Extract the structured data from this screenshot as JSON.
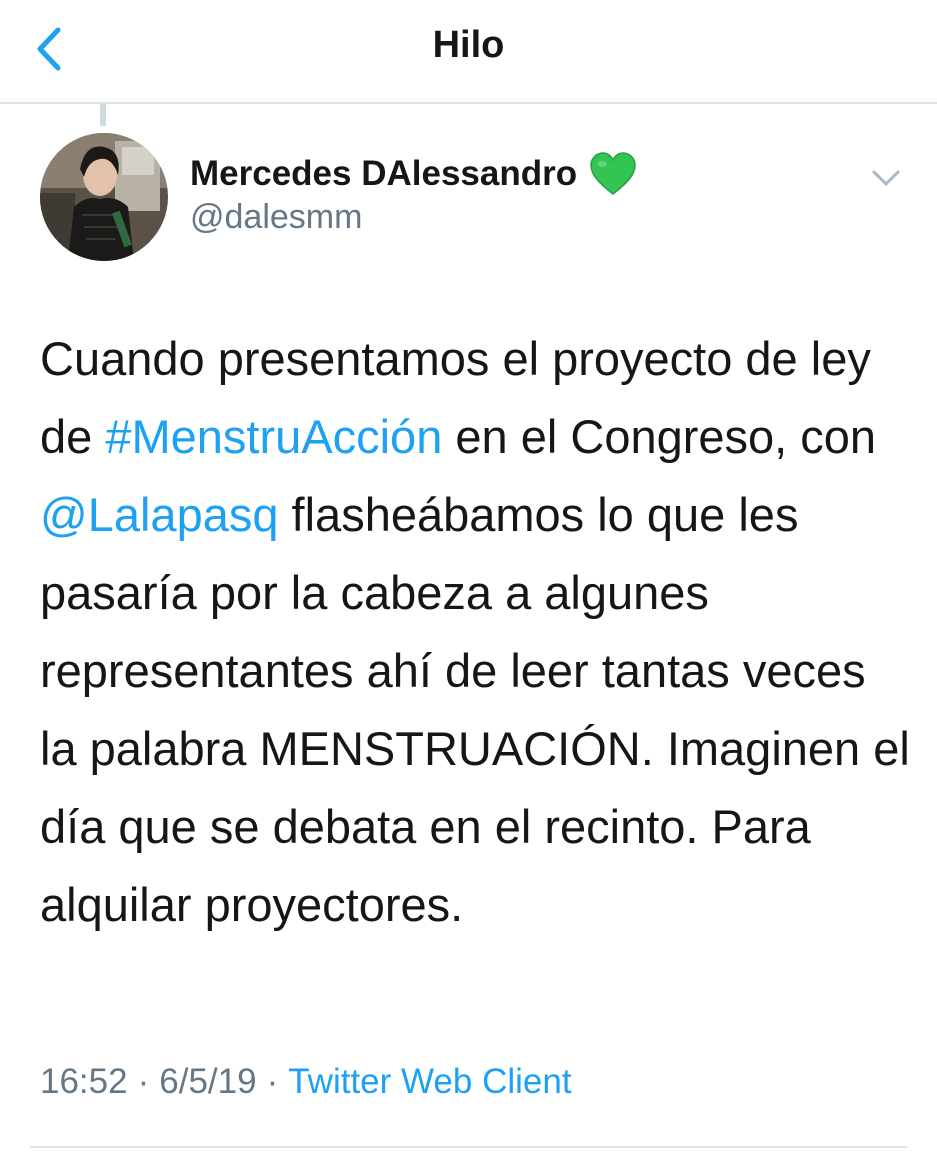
{
  "header": {
    "title": "Hilo",
    "back_icon": "chevron-left-icon"
  },
  "tweet": {
    "author_name": "Mercedes DAlessandro",
    "author_emoji": "💚",
    "author_handle": "@dalesmm",
    "text_parts": {
      "p1": "Cuando presentamos el proyecto de ley de ",
      "hashtag": "#MenstruAcción",
      "p2": " en el Congreso, con ",
      "mention": "@Lalapasq",
      "p3": " flasheábamos lo que les pasaría por la cabeza a algunes representantes ahí de leer tantas veces la palabra MENSTRUACIÓN. Imaginen el día que se debata en el recinto. Para alquilar proyectores."
    },
    "time": "16:52",
    "separator": "·",
    "date": "6/5/19",
    "source": "Twitter Web Client"
  },
  "colors": {
    "link": "#1da1f2",
    "secondary_text": "#657786",
    "divider": "#dfe4e8",
    "heart": "#33c452"
  }
}
